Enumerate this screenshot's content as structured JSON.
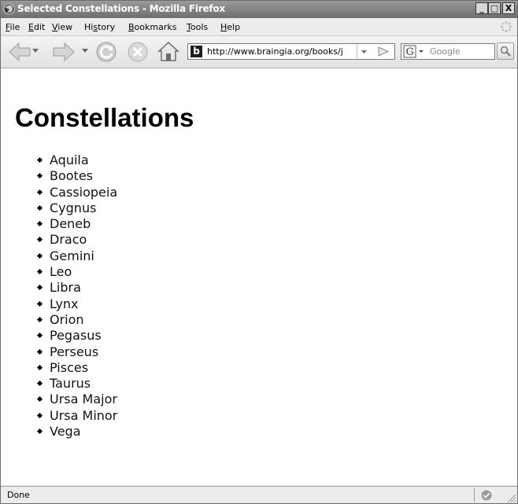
{
  "window": {
    "title": "Selected Constellations - Mozilla Firefox",
    "controls": {
      "minimize": "_",
      "maximize": "□",
      "close": "X"
    }
  },
  "menubar": {
    "items": [
      {
        "label": "File",
        "accel": "F"
      },
      {
        "label": "Edit",
        "accel": "E"
      },
      {
        "label": "View",
        "accel": "V"
      },
      {
        "label": "History",
        "accel": "s"
      },
      {
        "label": "Bookmarks",
        "accel": "B"
      },
      {
        "label": "Tools",
        "accel": "T"
      },
      {
        "label": "Help",
        "accel": "H"
      }
    ]
  },
  "toolbar": {
    "url": "http://www.braingia.org/books/j",
    "favicon_letter": "b",
    "search_engine": "G",
    "search_placeholder": "Google",
    "icons": [
      "back-icon",
      "forward-icon",
      "reload-icon",
      "stop-icon",
      "home-icon",
      "search-icon"
    ]
  },
  "page": {
    "heading": "Constellations",
    "items": [
      "Aquila",
      "Bootes",
      "Cassiopeia",
      "Cygnus",
      "Deneb",
      "Draco",
      "Gemini",
      "Leo",
      "Libra",
      "Lynx",
      "Orion",
      "Pegasus",
      "Perseus",
      "Pisces",
      "Taurus",
      "Ursa Major",
      "Ursa Minor",
      "Vega"
    ]
  },
  "statusbar": {
    "text": "Done"
  },
  "colors": {
    "titlebar": "#7a7a7a",
    "chrome": "#ececec",
    "page_bg": "#ffffff"
  }
}
